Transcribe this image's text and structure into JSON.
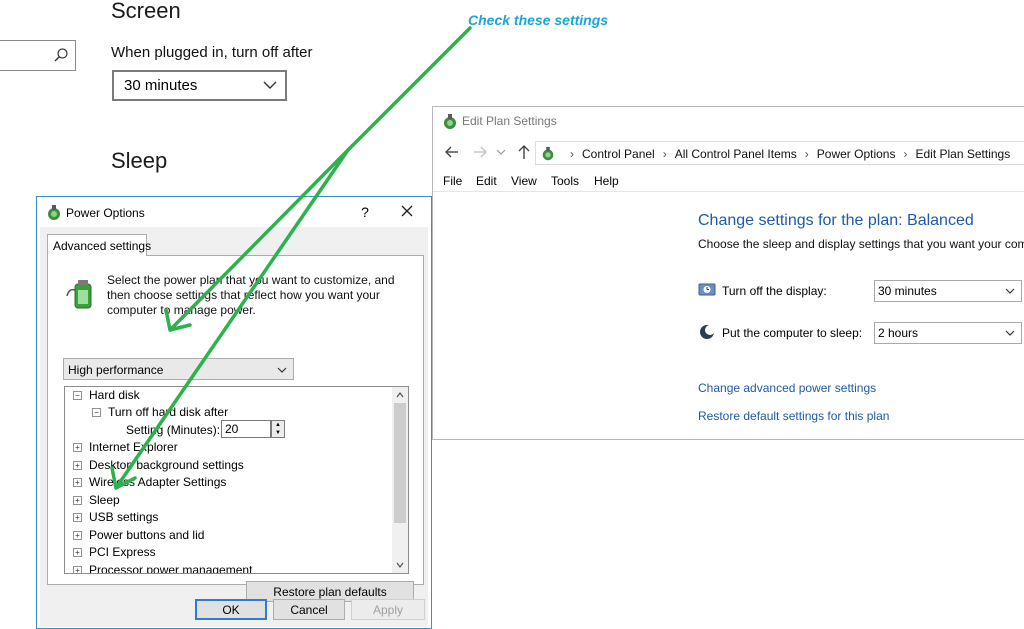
{
  "settings": {
    "search_icon": "search-icon",
    "screen_heading": "Screen",
    "plugged_label": "When plugged in, turn off after",
    "minutes_value": "30 minutes",
    "sleep_heading": "Sleep"
  },
  "edit_plan": {
    "title": "Edit Plan Settings",
    "breadcrumbs": [
      "Control Panel",
      "All Control Panel Items",
      "Power Options",
      "Edit Plan Settings"
    ],
    "menu": [
      "File",
      "Edit",
      "View",
      "Tools",
      "Help"
    ],
    "plan_title": "Change settings for the plan: Balanced",
    "plan_desc": "Choose the sleep and display settings that you want your comp",
    "display_label": "Turn off the display:",
    "display_value": "30 minutes",
    "sleep_label": "Put the computer to sleep:",
    "sleep_value": "2 hours",
    "link_advanced": "Change advanced power settings",
    "link_restore": "Restore default settings for this plan"
  },
  "power_options": {
    "title": "Power Options",
    "help": "?",
    "tab": "Advanced settings",
    "intro": "Select the power plan that you want to customize, and then choose settings that reflect how you want your computer to manage power.",
    "plan_value": "High performance",
    "tree": {
      "hard_disk": "Hard disk",
      "turn_off_hd": "Turn off hard disk after",
      "setting_label": "Setting (Minutes):",
      "setting_value": "20",
      "items": [
        "Internet Explorer",
        "Desktop background settings",
        "Wireless Adapter Settings",
        "Sleep",
        "USB settings",
        "Power buttons and lid",
        "PCI Express",
        "Processor power management"
      ]
    },
    "restore_btn": "Restore plan defaults",
    "ok": "OK",
    "cancel": "Cancel",
    "apply": "Apply"
  },
  "annotation": {
    "text": "Check these settings",
    "color": "#1aa6d9",
    "arrow_color": "#2bb24c"
  }
}
